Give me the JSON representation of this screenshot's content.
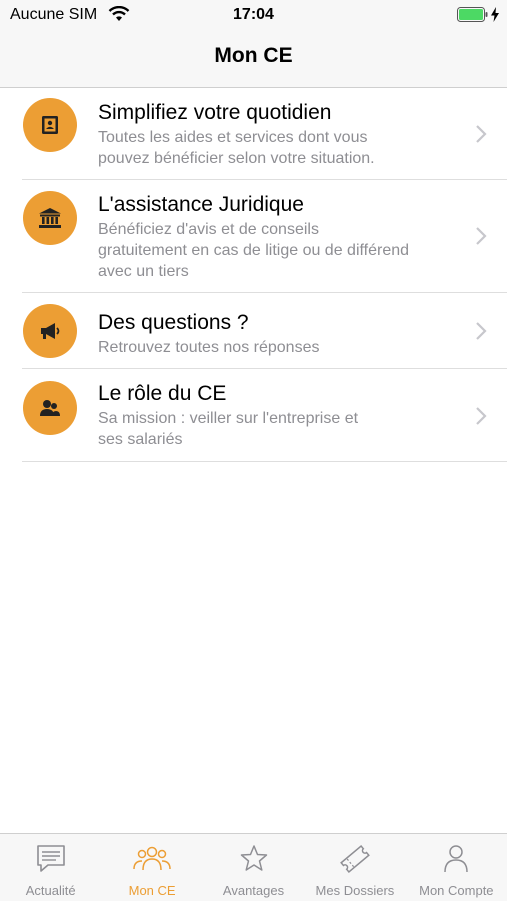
{
  "status_bar": {
    "carrier": "Aucune SIM",
    "time": "17:04",
    "battery_color": "#4cd964"
  },
  "header": {
    "title": "Mon CE"
  },
  "list": [
    {
      "title": "Simplifiez votre quotidien",
      "subtitle_lines": [
        "Toutes les aides et services dont vous",
        "pouvez bénéficier selon votre situation."
      ],
      "icon": "id-card-icon"
    },
    {
      "title": "L'assistance Juridique",
      "subtitle_lines": [
        "Bénéficiez d'avis et de conseils",
        "gratuitement en cas de litige ou de différend",
        "avec un tiers"
      ],
      "icon": "courthouse-icon"
    },
    {
      "title": "Des questions ?",
      "subtitle_lines": [
        "Retrouvez toutes nos réponses"
      ],
      "icon": "megaphone-icon"
    },
    {
      "title": "Le rôle du CE",
      "subtitle_lines": [
        "Sa mission : veiller sur l'entreprise et",
        "ses salariés"
      ],
      "icon": "people-icon"
    }
  ],
  "tab_bar": {
    "active_index": 1,
    "tabs": [
      {
        "label": "Actualité",
        "icon": "message-icon"
      },
      {
        "label": "Mon CE",
        "icon": "group-icon"
      },
      {
        "label": "Avantages",
        "icon": "star-icon"
      },
      {
        "label": "Mes Dossiers",
        "icon": "ticket-icon"
      },
      {
        "label": "Mon Compte",
        "icon": "person-icon"
      }
    ]
  },
  "colors": {
    "accent": "#ec9e34",
    "inactive": "#8e8e93",
    "bar_background": "#f7f7f7"
  }
}
